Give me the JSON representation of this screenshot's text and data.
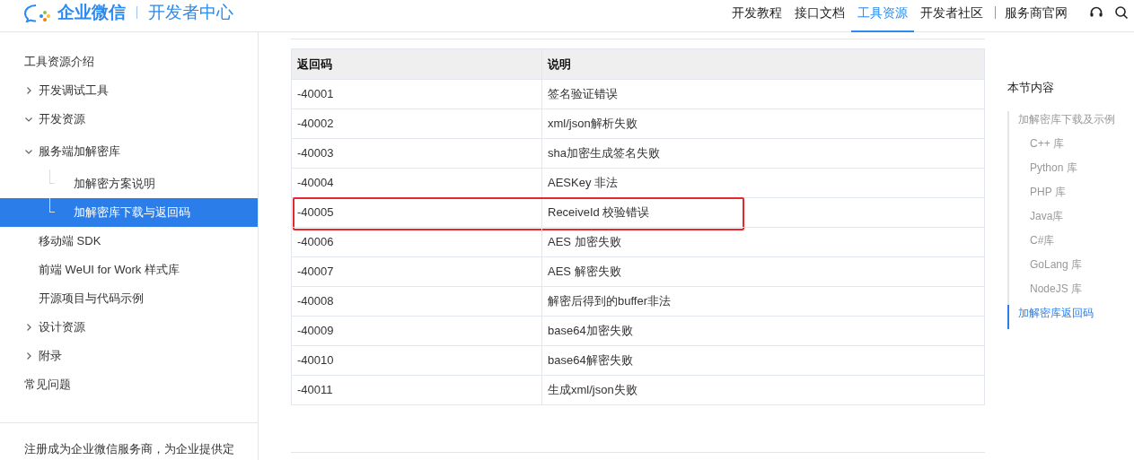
{
  "header": {
    "logo": "企业微信",
    "portal": "开发者中心",
    "links": [
      {
        "label": "开发教程",
        "selected": false
      },
      {
        "label": "接口文档",
        "selected": false
      },
      {
        "label": "工具资源",
        "selected": true
      },
      {
        "label": "开发者社区",
        "selected": false
      }
    ],
    "external_link": "服务商官网"
  },
  "sidebar": {
    "items": [
      {
        "label": "工具资源介绍",
        "selected": false
      },
      {
        "label": "开发调试工具",
        "expanded": false,
        "selected": false
      },
      {
        "label": "开发资源",
        "expanded": true,
        "selected": false,
        "children": [
          {
            "label": "服务端加解密库",
            "expanded": true,
            "selected": false,
            "children": [
              {
                "label": "加解密方案说明",
                "selected": false
              },
              {
                "label": "加解密库下载与返回码",
                "selected": true
              }
            ]
          },
          {
            "label": "移动端 SDK",
            "selected": false
          },
          {
            "label": "前端 WeUI for Work 样式库",
            "selected": false
          },
          {
            "label": "开源项目与代码示例",
            "selected": false
          }
        ]
      },
      {
        "label": "设计资源",
        "expanded": false,
        "selected": false
      },
      {
        "label": "附录",
        "expanded": false,
        "selected": false
      },
      {
        "label": "常见问题",
        "selected": false
      }
    ],
    "footer_text": "注册成为企业微信服务商，为企业提供定"
  },
  "table": {
    "columns": [
      "返回码",
      "说明"
    ],
    "rows": [
      {
        "code": "-40001",
        "description": "签名验证错误",
        "highlighted": false
      },
      {
        "code": "-40002",
        "description": "xml/json解析失败",
        "highlighted": false
      },
      {
        "code": "-40003",
        "description": "sha加密生成签名失败",
        "highlighted": false
      },
      {
        "code": "-40004",
        "description": "AESKey 非法",
        "highlighted": false
      },
      {
        "code": "-40005",
        "description": "ReceiveId 校验错误",
        "highlighted": true
      },
      {
        "code": "-40006",
        "description": "AES 加密失败",
        "highlighted": false
      },
      {
        "code": "-40007",
        "description": "AES 解密失败",
        "highlighted": false
      },
      {
        "code": "-40008",
        "description": "解密后得到的buffer非法",
        "highlighted": false
      },
      {
        "code": "-40009",
        "description": "base64加密失败",
        "highlighted": false
      },
      {
        "code": "-40010",
        "description": "base64解密失败",
        "highlighted": false
      },
      {
        "code": "-40011",
        "description": "生成xml/json失败",
        "highlighted": false
      }
    ]
  },
  "toc": {
    "title": "本节内容",
    "items": [
      {
        "label": "加解密库下载及示例",
        "selected": false,
        "children": [
          {
            "label": "C++ 库",
            "selected": false
          },
          {
            "label": "Python 库",
            "selected": false
          },
          {
            "label": "PHP 库",
            "selected": false
          },
          {
            "label": "Java库",
            "selected": false
          },
          {
            "label": "C#库",
            "selected": false
          },
          {
            "label": "GoLang 库",
            "selected": false
          },
          {
            "label": "NodeJS 库",
            "selected": false
          }
        ]
      },
      {
        "label": "加解密库返回码",
        "selected": true
      }
    ]
  }
}
